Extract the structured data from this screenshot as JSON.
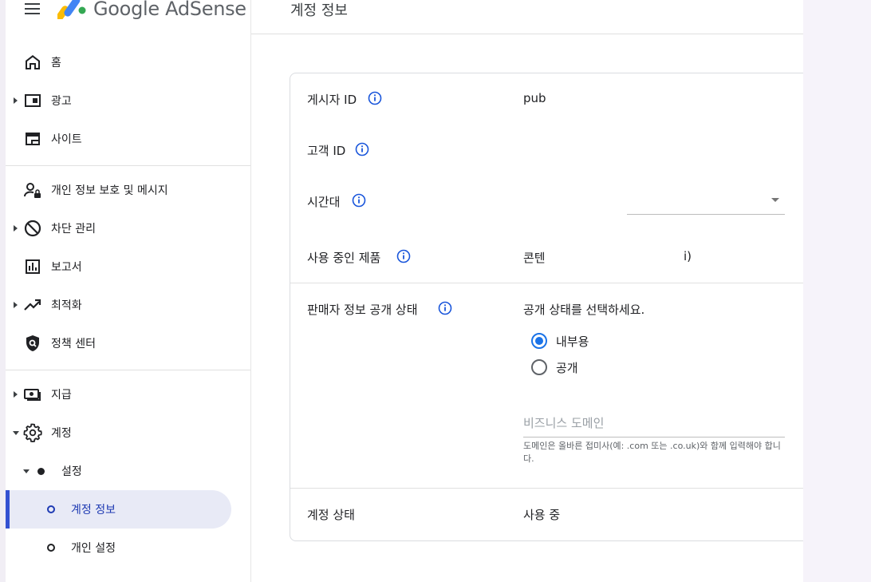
{
  "header": {
    "brand": "Google AdSense",
    "page_title": "계정 정보"
  },
  "sidebar": {
    "items": [
      {
        "label": "홈"
      },
      {
        "label": "광고"
      },
      {
        "label": "사이트"
      },
      {
        "label": "개인 정보 보호 및 메시지"
      },
      {
        "label": "차단 관리"
      },
      {
        "label": "보고서"
      },
      {
        "label": "최적화"
      },
      {
        "label": "정책 센터"
      },
      {
        "label": "지급"
      },
      {
        "label": "계정"
      },
      {
        "label": "설정"
      },
      {
        "label": "계정 정보"
      },
      {
        "label": "개인 설정"
      }
    ]
  },
  "account_info": {
    "publisher_id": {
      "label": "게시자 ID",
      "value": "pub"
    },
    "customer_id": {
      "label": "고객 ID",
      "value": ""
    },
    "timezone": {
      "label": "시간대",
      "value": ""
    },
    "products": {
      "label": "사용 중인 제품",
      "value": "콘텐",
      "value_tail": "i)"
    },
    "seller_visibility": {
      "label": "판매자 정보 공개 상태",
      "prompt": "공개 상태를 선택하세요.",
      "options": [
        {
          "label": "내부용",
          "checked": true
        },
        {
          "label": "공개",
          "checked": false
        }
      ],
      "domain_placeholder": "비즈니스 도메인",
      "domain_helper": "도메인은 올바른 접미사(예: .com 또는 .co.uk)와 함께 입력해야 합니다."
    },
    "account_status": {
      "label": "계정 상태",
      "value": "사용 중"
    }
  },
  "colors": {
    "accent": "#1a73e8",
    "active_nav_bg": "#e8eaf6",
    "active_nav_text": "#1f3bb3"
  }
}
